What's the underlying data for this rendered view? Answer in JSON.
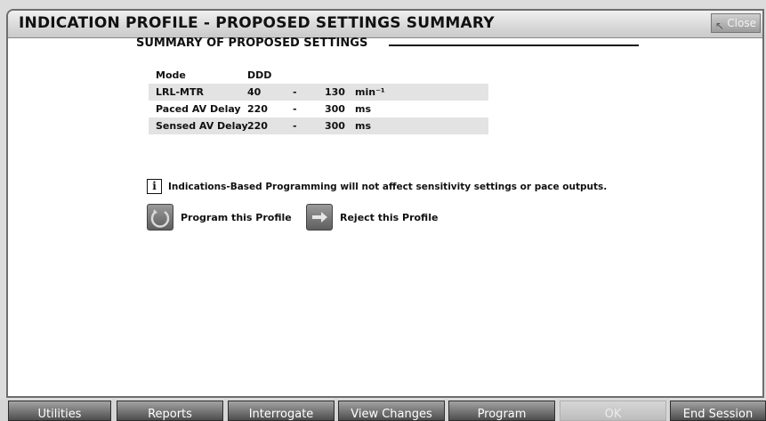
{
  "window": {
    "title": "INDICATION PROFILE - PROPOSED SETTINGS SUMMARY",
    "close_label": "Close"
  },
  "summary": {
    "heading": "SUMMARY OF PROPOSED SETTINGS",
    "rows": [
      {
        "label": "Mode",
        "value1": "DDD",
        "dash": "",
        "value2": "",
        "unit": ""
      },
      {
        "label": "LRL-MTR",
        "value1": "40",
        "dash": "-",
        "value2": "130",
        "unit": "min⁻¹"
      },
      {
        "label": "Paced AV Delay",
        "value1": "220",
        "dash": "-",
        "value2": "300",
        "unit": "ms"
      },
      {
        "label": "Sensed AV Delay",
        "value1": "220",
        "dash": "-",
        "value2": "300",
        "unit": "ms"
      }
    ]
  },
  "info": {
    "icon": "info-icon",
    "text": "Indications-Based Programming will not affect sensitivity settings or pace outputs."
  },
  "actions": {
    "program_profile": "Program this Profile",
    "reject_profile": "Reject this Profile"
  },
  "bottom_bar": [
    {
      "label": "Utilities"
    },
    {
      "label": "Reports"
    },
    {
      "label": "Interrogate"
    },
    {
      "label": "View Changes"
    },
    {
      "label": "Program"
    },
    {
      "label": "OK"
    },
    {
      "label": "End Session"
    }
  ]
}
